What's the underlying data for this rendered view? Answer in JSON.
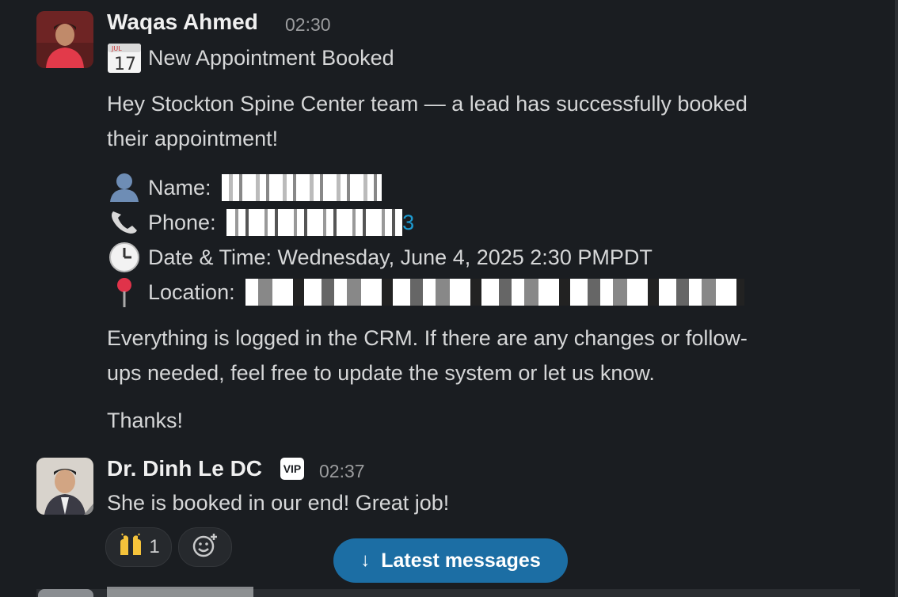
{
  "messages": [
    {
      "author": "Waqas Ahmed",
      "time": "02:30",
      "title": "New Appointment Booked",
      "calendar_month": "JUL",
      "calendar_day": "17",
      "intro": [
        "Hey Stockton Spine Center team — a lead has successfully booked",
        "their appointment!"
      ],
      "fields": {
        "name_label": "Name:",
        "phone_label": "Phone:",
        "phone_trailing": "3",
        "datetime": "Date & Time: Wednesday, June 4, 2025 2:30 PMPDT",
        "location_label": "Location:"
      },
      "body": [
        "Everything is logged in the CRM. If there are any changes or follow-",
        "ups needed, feel free to update the system or let us know."
      ],
      "signoff": "Thanks!"
    },
    {
      "author": "Dr. Dinh Le DC",
      "badge": "VIP",
      "time": "02:37",
      "text": "She is booked in our end!  Great job!",
      "reactions": [
        {
          "icon": "raised-hands-icon",
          "count": "1"
        },
        {
          "icon": "add-reaction-icon"
        }
      ]
    }
  ],
  "latest_button": {
    "label": "Latest messages",
    "icon": "arrow-down-icon"
  },
  "colors": {
    "background": "#1a1d21",
    "link": "#1d9bd1",
    "button": "#1c6ea4"
  }
}
